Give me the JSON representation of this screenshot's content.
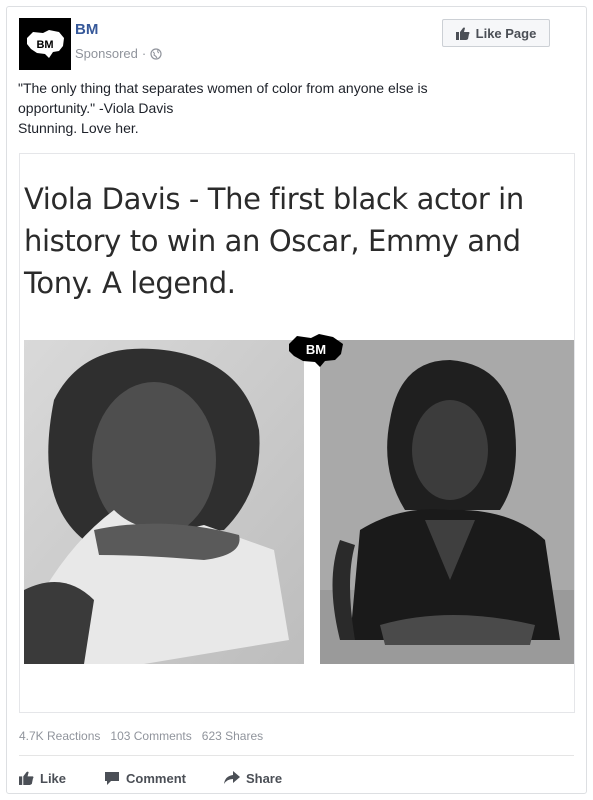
{
  "header": {
    "avatar_text": "BM",
    "page_name": "BM",
    "sponsored_label": "Sponsored",
    "separator": "·",
    "globe_icon": "globe-icon",
    "like_page_label": "Like Page"
  },
  "post": {
    "lines": [
      "\"The only thing that separates women of color from anyone else is",
      "opportunity.\" -Viola Davis",
      "Stunning. Love her."
    ]
  },
  "media": {
    "headline_lines": [
      "Viola Davis -  The first black actor in",
      "history to win an Oscar, Emmy and",
      "Tony. A legend."
    ],
    "watermark_text": "BM"
  },
  "stats": {
    "reactions": "4.7K Reactions",
    "comments": "103 Comments",
    "shares": "623 Shares"
  },
  "actions": {
    "like": "Like",
    "comment": "Comment",
    "share": "Share"
  },
  "colors": {
    "link_blue": "#365899",
    "meta_gray": "#90949c",
    "action_gray": "#4b4f56"
  }
}
